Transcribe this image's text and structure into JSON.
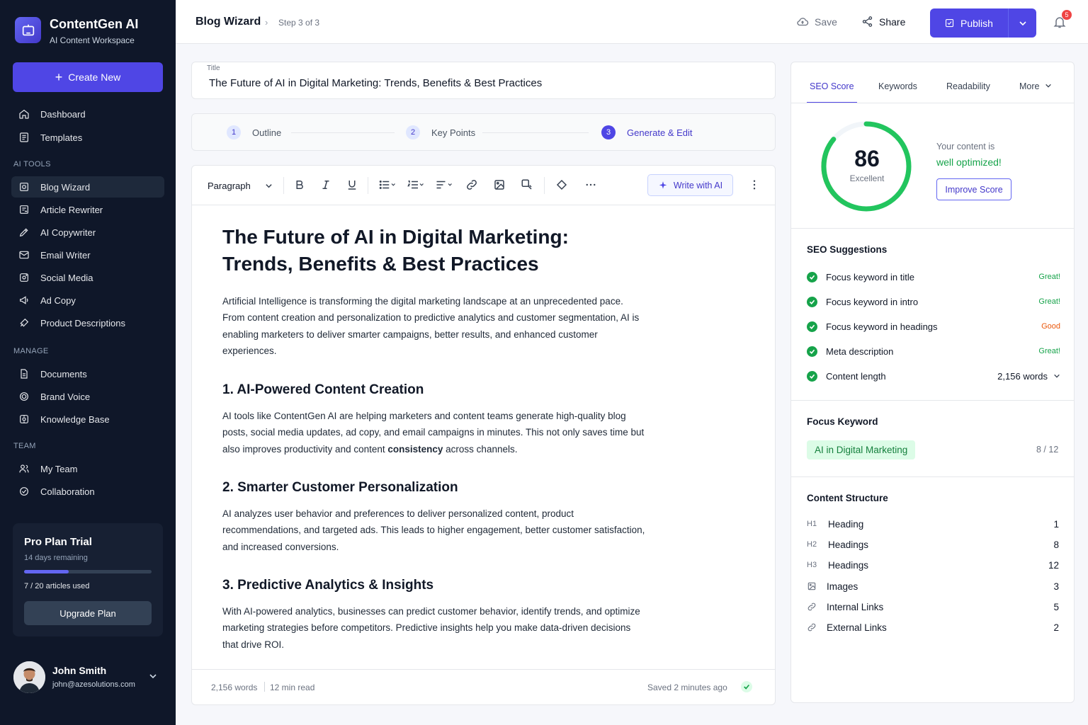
{
  "app": {
    "name": "ContentGen AI",
    "subtitle": "AI Content Workspace"
  },
  "sidebar": {
    "create_label": "Create New",
    "main_items": [
      {
        "label": "Dashboard",
        "icon": "home-icon"
      },
      {
        "label": "Templates",
        "icon": "templates-icon"
      }
    ],
    "sections": [
      {
        "label": "AI TOOLS",
        "items": [
          {
            "label": "Blog Wizard",
            "icon": "blog-icon",
            "active": true
          },
          {
            "label": "Article Rewriter",
            "icon": "rewrite-icon"
          },
          {
            "label": "AI Copywriter",
            "icon": "pen-icon"
          },
          {
            "label": "Email Writer",
            "icon": "mail-icon"
          },
          {
            "label": "Social Media",
            "icon": "social-icon"
          },
          {
            "label": "Ad Copy",
            "icon": "megaphone-icon"
          },
          {
            "label": "Product Descriptions",
            "icon": "tag-icon"
          }
        ]
      },
      {
        "label": "MANAGE",
        "items": [
          {
            "label": "Documents",
            "icon": "document-icon"
          },
          {
            "label": "Brand Voice",
            "icon": "target-icon"
          },
          {
            "label": "Knowledge Base",
            "icon": "database-icon"
          }
        ]
      },
      {
        "label": "TEAM",
        "items": [
          {
            "label": "My Team",
            "icon": "users-icon"
          },
          {
            "label": "Collaboration",
            "icon": "collab-icon"
          }
        ]
      }
    ],
    "plan": {
      "title": "Pro Plan Trial",
      "days": "14 days remaining",
      "progress": 0.35,
      "used": "7 / 20 articles used",
      "upgrade_label": "Upgrade Plan"
    },
    "user": {
      "name": "John Smith",
      "email": "john@azesolutions.com"
    }
  },
  "topbar": {
    "title": "Blog Wizard",
    "step": "Step 3 of 3",
    "save_label": "Save",
    "share_label": "Share",
    "publish_label": "Publish",
    "notification_count": "5"
  },
  "title_field": {
    "label": "Title",
    "value": "The Future of AI in Digital Marketing: Trends, Benefits & Best Practices"
  },
  "steps": [
    {
      "num": "1",
      "label": "Outline"
    },
    {
      "num": "2",
      "label": "Key Points"
    },
    {
      "num": "3",
      "label": "Generate & Edit",
      "active": true
    }
  ],
  "toolbar": {
    "block_type": "Paragraph",
    "write_ai_label": "Write with AI"
  },
  "document": {
    "h1": "The Future of AI in Digital Marketing: Trends, Benefits & Best Practices",
    "intro": "Artificial Intelligence is transforming the digital marketing landscape at an unprecedented pace. From content creation and personalization to predictive analytics and customer segmentation, AI is enabling marketers to deliver smarter campaigns, better results, and enhanced customer experiences.",
    "s1_title": "1. AI-Powered Content Creation",
    "s1_before": "AI tools like ContentGen AI are helping marketers and content teams generate high-quality blog posts, social media updates, ad copy, and email campaigns in minutes. This not only saves time but also improves productivity and content ",
    "s1_bold": "consistency",
    "s1_after": " across channels.",
    "s2_title": "2. Smarter Customer Personalization",
    "s2_body": "AI analyzes user behavior and preferences to deliver personalized content, product recommendations, and targeted ads. This leads to higher engagement, better customer satisfaction, and increased conversions.",
    "s3_title": "3. Predictive Analytics & Insights",
    "s3_body": "With AI-powered analytics, businesses can predict customer behavior, identify trends, and optimize marketing strategies before competitors. Predictive insights help you make data-driven decisions that drive ROI."
  },
  "editor_footer": {
    "words": "2,156 words",
    "read": "12 min read",
    "saved": "Saved 2 minutes ago"
  },
  "right_panel": {
    "tabs": [
      "SEO Score",
      "Keywords",
      "Readability",
      "More"
    ],
    "score": {
      "value": "86",
      "value_fraction": 0.86,
      "label": "Excellent",
      "line1": "Your content is",
      "line2": "well optimized!",
      "improve_label": "Improve Score",
      "colors": {
        "good": "#22c55e",
        "warn": "#f59e0b"
      }
    },
    "suggestions_title": "SEO Suggestions",
    "suggestions": [
      {
        "label": "Focus keyword in title",
        "status": "Great!",
        "color": "#16a34a"
      },
      {
        "label": "Focus keyword in intro",
        "status": "Great!",
        "color": "#16a34a"
      },
      {
        "label": "Focus keyword in headings",
        "status": "Good",
        "color": "#ea580c"
      },
      {
        "label": "Meta description",
        "status": "Great!",
        "color": "#16a34a"
      },
      {
        "label": "Content length",
        "status": "2,156 words",
        "color": "#111827"
      }
    ],
    "focus_title": "Focus Keyword",
    "focus_keyword": "AI in Digital Marketing",
    "focus_count": "8 / 12",
    "structure_title": "Content Structure",
    "structure": [
      {
        "tag": "H1",
        "label": "Heading",
        "value": "1"
      },
      {
        "tag": "H2",
        "label": "Headings",
        "value": "8"
      },
      {
        "tag": "H3",
        "label": "Headings",
        "value": "12"
      },
      {
        "icon": "image-icon",
        "label": "Images",
        "value": "3"
      },
      {
        "icon": "link-icon",
        "label": "Internal Links",
        "value": "5"
      },
      {
        "icon": "external-link-icon",
        "label": "External Links",
        "value": "2"
      }
    ]
  },
  "colors": {
    "accent": "#4f46e5",
    "sidebar": "#0f1729",
    "success": "#16a34a"
  }
}
